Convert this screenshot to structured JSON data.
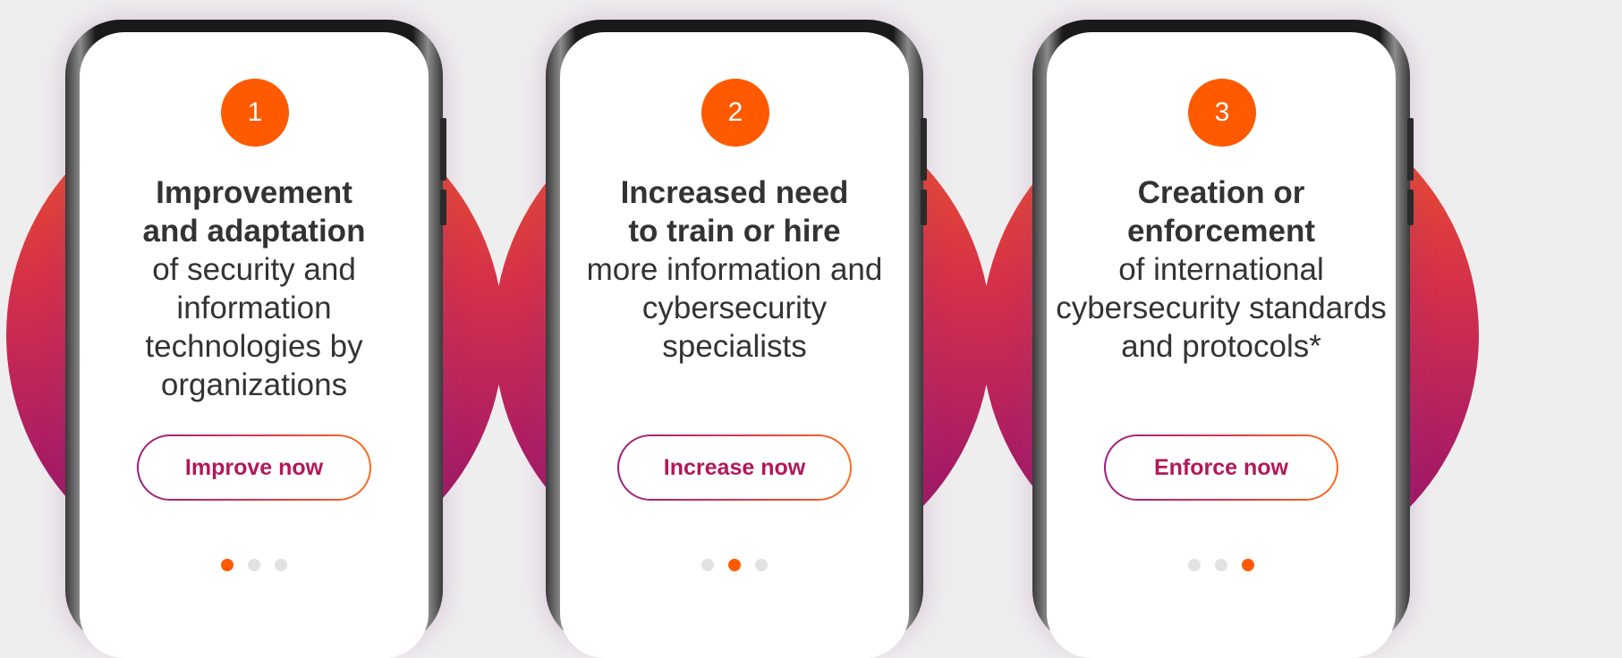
{
  "colors": {
    "background": "#efeeef",
    "accent_orange": "#ff5a00",
    "text": "#333333",
    "button_text": "#b3175a",
    "inactive_dot": "#e2e2e2"
  },
  "cards": [
    {
      "number": "1",
      "bold_line1": "Improvement",
      "bold_line2": "and adaptation",
      "rest": "of security and information technologies by organizations",
      "button_label": "Improve now",
      "active_dot": 0
    },
    {
      "number": "2",
      "bold_line1": "Increased need",
      "bold_line2": "to train or hire",
      "rest": "more information and cybersecurity specialists",
      "button_label": "Increase now",
      "active_dot": 1
    },
    {
      "number": "3",
      "bold_line1": "Creation or",
      "bold_line2": "enforcement",
      "rest": "of international cybersecurity standards and protocols*",
      "button_label": "Enforce now",
      "active_dot": 2
    }
  ]
}
